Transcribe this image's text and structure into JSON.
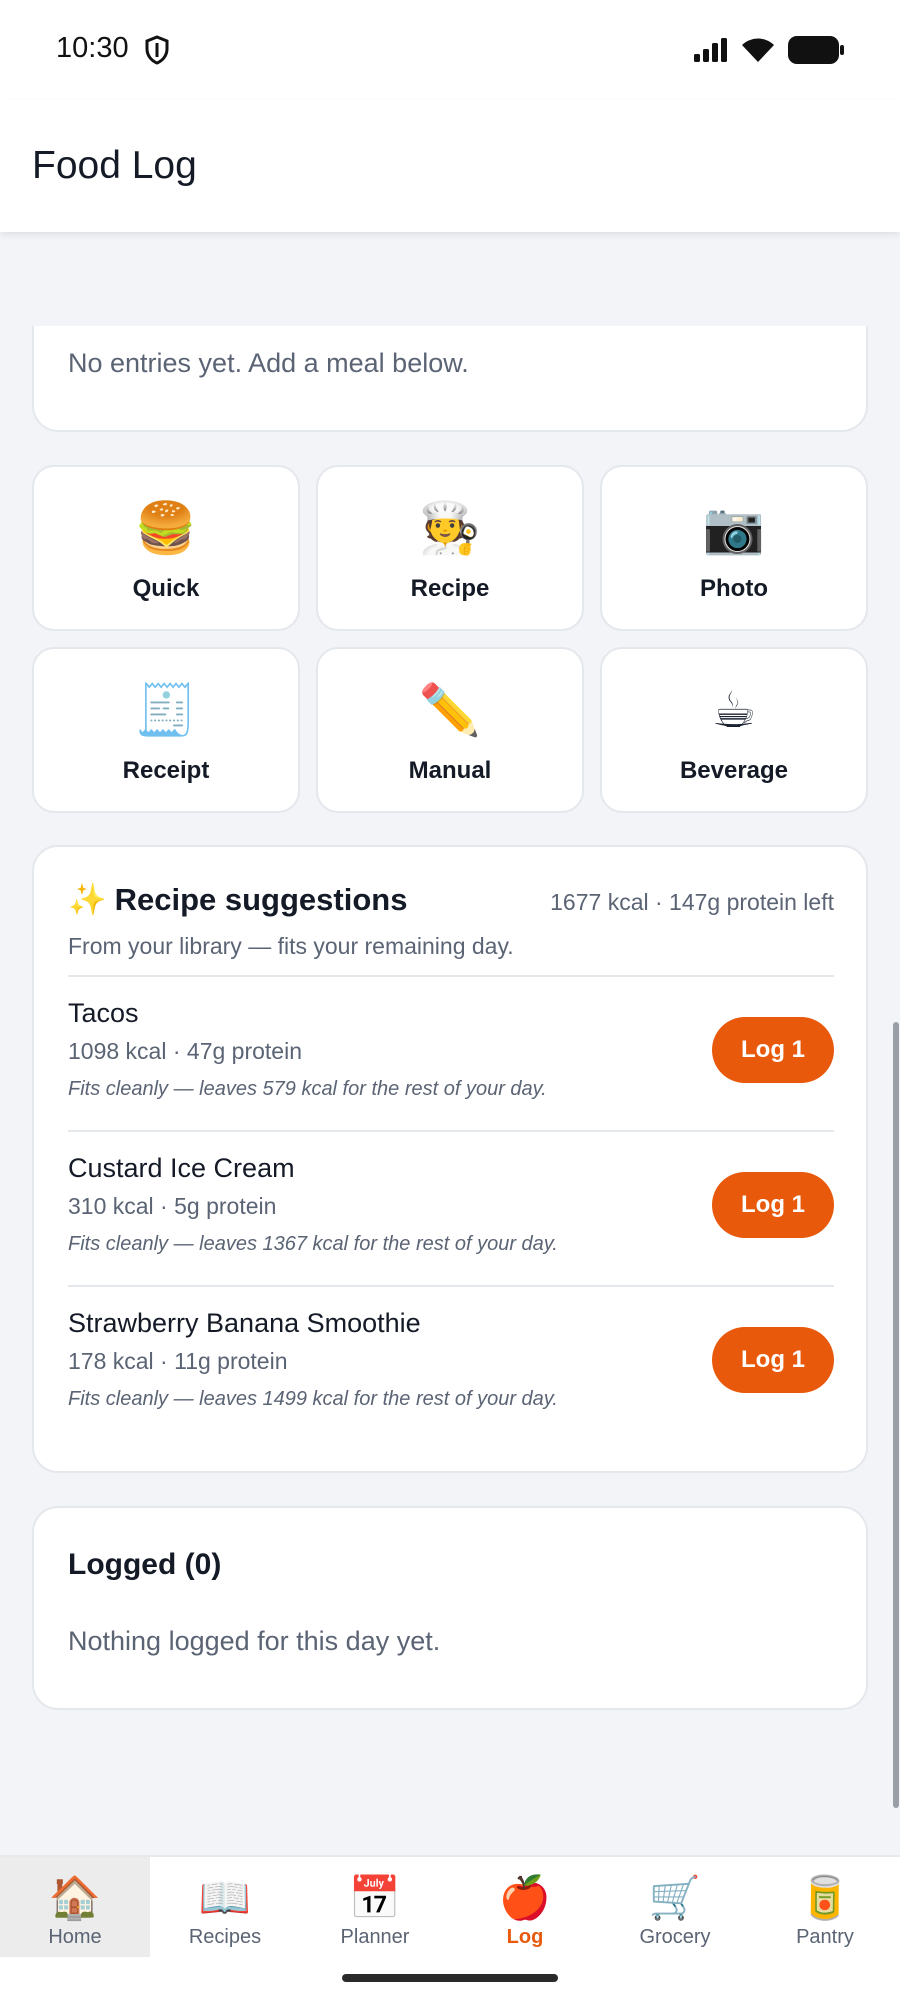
{
  "status_bar": {
    "time": "10:30",
    "icons": [
      "shield-icon",
      "signal-icon",
      "wifi-icon",
      "battery-icon"
    ]
  },
  "header": {
    "title": "Food Log"
  },
  "entries_card": {
    "empty_text": "No entries yet. Add a meal below."
  },
  "actions": [
    {
      "label": "Quick",
      "emoji": "🍔",
      "icon": "burger-icon"
    },
    {
      "label": "Recipe",
      "emoji": "🧑‍🍳",
      "icon": "chef-icon"
    },
    {
      "label": "Photo",
      "emoji": "📷",
      "icon": "camera-icon"
    },
    {
      "label": "Receipt",
      "emoji": "🧾",
      "icon": "receipt-icon"
    },
    {
      "label": "Manual",
      "emoji": "✏️",
      "icon": "pencil-icon"
    },
    {
      "label": "Beverage",
      "emoji": "☕",
      "icon": "coffee-icon"
    }
  ],
  "suggestions": {
    "emoji": "✨",
    "title": "Recipe suggestions",
    "remaining": "1677 kcal · 147g protein left",
    "subtitle": "From your library — fits your remaining day.",
    "items": [
      {
        "name": "Tacos",
        "meta": "1098 kcal · 47g protein",
        "note": "Fits cleanly — leaves 579 kcal for the rest of your day.",
        "button": "Log 1"
      },
      {
        "name": "Custard Ice Cream",
        "meta": "310 kcal · 5g protein",
        "note": "Fits cleanly — leaves 1367 kcal for the rest of your day.",
        "button": "Log 1"
      },
      {
        "name": "Strawberry Banana Smoothie",
        "meta": "178 kcal · 11g protein",
        "note": "Fits cleanly — leaves 1499 kcal for the rest of your day.",
        "button": "Log 1"
      }
    ]
  },
  "logged": {
    "title": "Logged (0)",
    "empty_text": "Nothing logged for this day yet."
  },
  "nav": {
    "items": [
      {
        "label": "Home",
        "emoji": "🏠",
        "icon": "home-icon"
      },
      {
        "label": "Recipes",
        "emoji": "📖",
        "icon": "book-icon"
      },
      {
        "label": "Planner",
        "emoji": "📅",
        "icon": "calendar-icon"
      },
      {
        "label": "Log",
        "emoji": "🍎",
        "icon": "apple-icon"
      },
      {
        "label": "Grocery",
        "emoji": "🛒",
        "icon": "cart-icon"
      },
      {
        "label": "Pantry",
        "emoji": "🥫",
        "icon": "can-icon"
      }
    ],
    "active": "Log",
    "accent_color": "#e8590c"
  }
}
